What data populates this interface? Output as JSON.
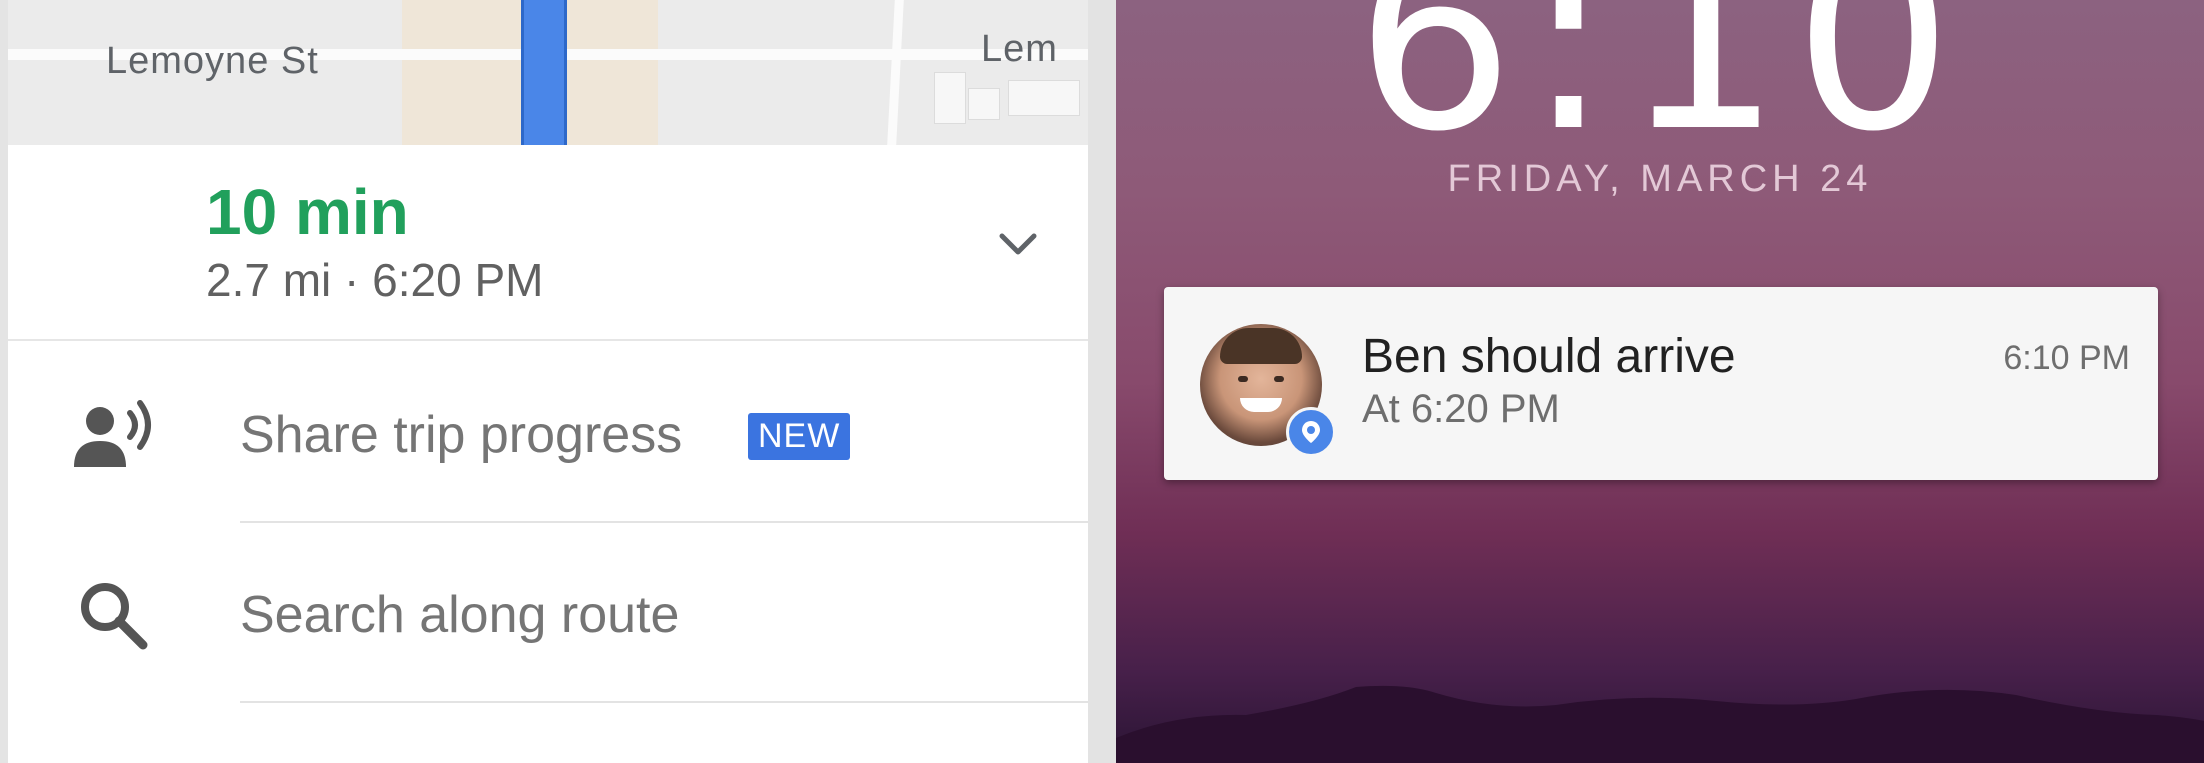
{
  "map": {
    "street_left": "Lemoyne St",
    "street_right": "Lem",
    "colors": {
      "route": "#4a86e8"
    }
  },
  "eta": {
    "duration": "10 min",
    "details": "2.7 mi · 6:20 PM",
    "expand_icon": "chevron-down-icon",
    "accent_color": "#21a05c"
  },
  "menu": {
    "items": [
      {
        "label": "Share trip progress",
        "icon": "share-location-person-icon",
        "badge": "NEW"
      },
      {
        "label": "Search along route",
        "icon": "search-icon"
      }
    ]
  },
  "lockscreen": {
    "clock": "6:10",
    "date": "FRIDAY, MARCH 24",
    "notification": {
      "title": "Ben should arrive",
      "subtitle": "At 6:20 PM",
      "time": "6:10 PM",
      "app_icon": "maps-location-icon"
    }
  }
}
